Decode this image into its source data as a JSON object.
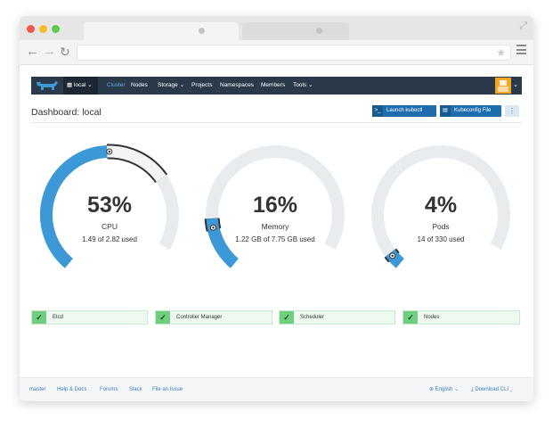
{
  "browser": {
    "tabs": [
      "",
      ""
    ]
  },
  "header": {
    "cluster_name": "local",
    "nav": [
      {
        "label": "Cluster",
        "active": true
      },
      {
        "label": "Nodes"
      },
      {
        "label": "Storage",
        "dropdown": true
      },
      {
        "label": "Projects"
      },
      {
        "label": "Namespaces"
      },
      {
        "label": "Members"
      },
      {
        "label": "Tools",
        "dropdown": true
      }
    ],
    "colors": {
      "bar": "#2b3a4a",
      "accent": "#3d98d6",
      "avatar": "#f5a623"
    }
  },
  "page": {
    "title": "Dashboard: local",
    "actions": {
      "launch_kubectl": "Launch kubectl",
      "kubeconfig": "Kubeconfig File",
      "more": "⋮"
    }
  },
  "gauges": [
    {
      "name": "cpu",
      "percent_label": "53%",
      "label": "CPU",
      "detail": "1.49 of 2.82 used",
      "value": 0.53,
      "reserved_range": [
        0.53,
        0.75
      ]
    },
    {
      "name": "memory",
      "percent_label": "16%",
      "label": "Memory",
      "detail": "1.22 GB of 7.75 GB used",
      "value": 0.16,
      "reserved_range": [
        0.14,
        0.18
      ]
    },
    {
      "name": "pods",
      "percent_label": "4%",
      "label": "Pods",
      "detail": "14 of 330 used",
      "value": 0.04,
      "reserved_range": [
        0.03,
        0.05
      ]
    }
  ],
  "components": [
    {
      "label": "Etcd",
      "status": "healthy"
    },
    {
      "label": "Controller Manager",
      "status": "healthy"
    },
    {
      "label": "Scheduler",
      "status": "healthy"
    },
    {
      "label": "Nodes",
      "status": "healthy"
    }
  ],
  "footer": {
    "links": [
      "master",
      "Help & Docs",
      "Forums",
      "Slack",
      "File an Issue"
    ],
    "language": "English",
    "download": "Download CLI"
  }
}
